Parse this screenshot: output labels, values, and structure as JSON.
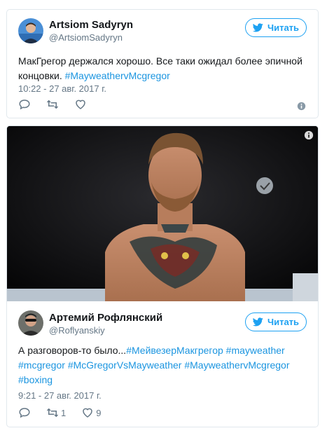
{
  "tweet1": {
    "author_name": "Artsiom Sadyryn",
    "author_handle": "@ArtsiomSadyryn",
    "follow_label": "Читать",
    "text_plain": "МакГрегор держался хорошо. Все таки ожидал более эпичной концовки. ",
    "hashtag": "#MayweathervMcgregor",
    "timestamp": "10:22 - 27 авг. 2017 г."
  },
  "tweet2": {
    "author_name": "Артемий Рофлянский",
    "author_handle": "@Roflyanskiy",
    "follow_label": "Читать",
    "text_plain": "А разговоров-то было...",
    "hashtags": [
      "#МейвезерМакгрегор",
      "#mayweather",
      "#mcgregor",
      "#McGregorVsMayweather",
      "#MayweathervMcgregor",
      "#boxing"
    ],
    "timestamp": "9:21 - 27 авг. 2017 г.",
    "retweets": "1",
    "likes": "9"
  },
  "icons": {
    "reply": "reply-icon",
    "retweet": "retweet-icon",
    "like": "heart-icon",
    "info": "info-icon",
    "bird": "twitter-bird-icon"
  },
  "colors": {
    "accent": "#1da1f2",
    "link": "#1b95e0",
    "muted": "#657786",
    "border": "#e1e8ed"
  }
}
